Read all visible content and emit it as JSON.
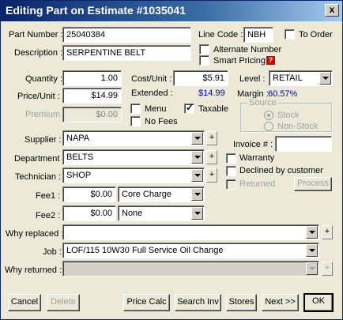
{
  "window": {
    "title": "Editing Part on Estimate #1035041",
    "close": "x"
  },
  "part_number": {
    "label": "Part Number :",
    "value": "25040384"
  },
  "line_code": {
    "label": "Line Code :",
    "value": "NBH"
  },
  "to_order": {
    "label": "To Order",
    "checked": false
  },
  "description": {
    "label": "Description :",
    "value": "SERPENTINE BELT"
  },
  "alternate_number": {
    "label": "Alternate Number",
    "checked": false
  },
  "smart_pricing": {
    "label": "Smart Pricing",
    "checked": false,
    "help": "?"
  },
  "quantity": {
    "label": "Quantity :",
    "value": "1.00"
  },
  "cost_unit": {
    "label": "Cost/Unit :",
    "value": "$5.91"
  },
  "level": {
    "label": "Level :",
    "value": "RETAIL"
  },
  "price_unit": {
    "label": "Price/Unit :",
    "value": "$14.99"
  },
  "extended": {
    "label": "Extended :",
    "value": "$14.99"
  },
  "margin": {
    "label": "Margin :",
    "value": "60.57%"
  },
  "premium": {
    "label": "Premium",
    "value": "$0.00"
  },
  "menu": {
    "label": "Menu",
    "checked": false
  },
  "taxable": {
    "label": "Taxable",
    "checked": true
  },
  "no_fees": {
    "label": "No Fees",
    "checked": false
  },
  "source": {
    "title": "Source",
    "stock": "Stock",
    "non_stock": "Non-Stock",
    "selected": "Stock"
  },
  "supplier": {
    "label": "Supplier :",
    "value": "NAPA"
  },
  "department": {
    "label": "Department :",
    "value": "BELTS"
  },
  "technician": {
    "label": "Technician :",
    "value": "SHOP"
  },
  "invoice": {
    "label": "Invoice # :",
    "value": ""
  },
  "warranty": {
    "label": "Warranty",
    "checked": false
  },
  "declined": {
    "label": "Declined by customer",
    "checked": false
  },
  "returned": {
    "label": "Returned",
    "checked": false
  },
  "process_button": "Process",
  "fee1": {
    "label": "Fee1 :",
    "amount": "$0.00",
    "type": "Core Charge"
  },
  "fee2": {
    "label": "Fee2 :",
    "amount": "$0.00",
    "type": "None"
  },
  "why_replaced": {
    "label": "Why replaced :",
    "value": ""
  },
  "job": {
    "label": "Job :",
    "value": "LOF/115 10W30 Full Service Oil Change"
  },
  "why_returned": {
    "label": "Why returned :",
    "value": ""
  },
  "plus": "+",
  "buttons": {
    "cancel": "Cancel",
    "delete": "Delete",
    "price_calc": "Price Calc",
    "search_inv": "Search Inv",
    "stores": "Stores",
    "next": "Next >>",
    "ok": "OK"
  }
}
